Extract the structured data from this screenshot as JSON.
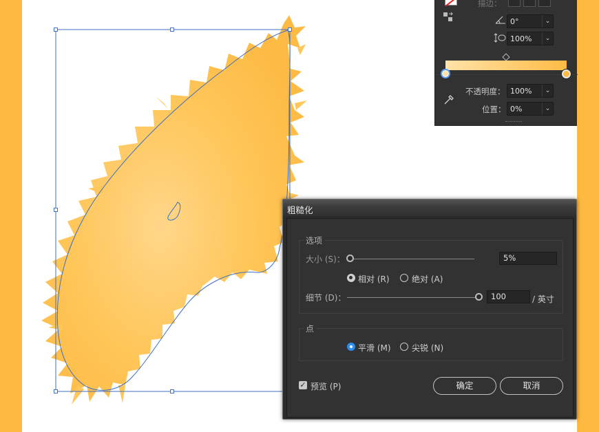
{
  "colors": {
    "accent_orange": "#fdb940",
    "shape_fill": "#ffc75c",
    "selection_blue": "#3d6fc2",
    "dialog_bg": "#323232",
    "radio_blue": "#2b8ef0"
  },
  "gradient_panel": {
    "stroke_label": "描边：",
    "angle_icon": "angle-icon",
    "angle_value": "0°",
    "aspect_icon": "aspect-ratio-icon",
    "aspect_value": "100%",
    "opacity_label": "不透明度：",
    "opacity_value": "100%",
    "location_label": "位置：",
    "location_value": "0%",
    "eyedropper_icon": "eyedropper-icon",
    "gradient_start_color": "#ffe3a8",
    "gradient_end_color": "#fdbb45"
  },
  "dialog": {
    "title": "粗糙化",
    "options_group": "选项",
    "size_label": "大小 (S)：",
    "size_value": "5%",
    "relative_label": "相对 (R)",
    "absolute_label": "绝对 (A)",
    "detail_label": "细节 (D)：",
    "detail_value": "100",
    "detail_unit": "/ 英寸",
    "points_group": "点",
    "smooth_label": "平滑 (M)",
    "corner_label": "尖锐 (N)",
    "preview_label": "预览 (P)",
    "ok_label": "确定",
    "cancel_label": "取消",
    "size_slider_fraction": 0.0,
    "detail_slider_fraction": 1.0,
    "relative_selected": true,
    "smooth_selected": true,
    "preview_checked": true
  }
}
